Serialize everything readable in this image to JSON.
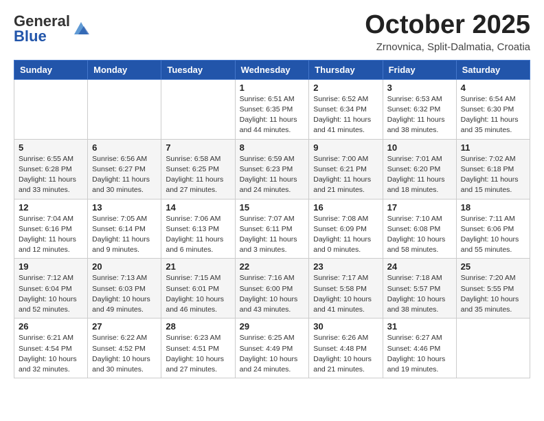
{
  "header": {
    "logo": {
      "general": "General",
      "blue": "Blue",
      "icon_title": "GeneralBlue Logo"
    },
    "title": "October 2025",
    "subtitle": "Zrnovnica, Split-Dalmatia, Croatia"
  },
  "weekdays": [
    "Sunday",
    "Monday",
    "Tuesday",
    "Wednesday",
    "Thursday",
    "Friday",
    "Saturday"
  ],
  "weeks": [
    [
      {
        "day": "",
        "info": ""
      },
      {
        "day": "",
        "info": ""
      },
      {
        "day": "",
        "info": ""
      },
      {
        "day": "1",
        "info": "Sunrise: 6:51 AM\nSunset: 6:35 PM\nDaylight: 11 hours\nand 44 minutes."
      },
      {
        "day": "2",
        "info": "Sunrise: 6:52 AM\nSunset: 6:34 PM\nDaylight: 11 hours\nand 41 minutes."
      },
      {
        "day": "3",
        "info": "Sunrise: 6:53 AM\nSunset: 6:32 PM\nDaylight: 11 hours\nand 38 minutes."
      },
      {
        "day": "4",
        "info": "Sunrise: 6:54 AM\nSunset: 6:30 PM\nDaylight: 11 hours\nand 35 minutes."
      }
    ],
    [
      {
        "day": "5",
        "info": "Sunrise: 6:55 AM\nSunset: 6:28 PM\nDaylight: 11 hours\nand 33 minutes."
      },
      {
        "day": "6",
        "info": "Sunrise: 6:56 AM\nSunset: 6:27 PM\nDaylight: 11 hours\nand 30 minutes."
      },
      {
        "day": "7",
        "info": "Sunrise: 6:58 AM\nSunset: 6:25 PM\nDaylight: 11 hours\nand 27 minutes."
      },
      {
        "day": "8",
        "info": "Sunrise: 6:59 AM\nSunset: 6:23 PM\nDaylight: 11 hours\nand 24 minutes."
      },
      {
        "day": "9",
        "info": "Sunrise: 7:00 AM\nSunset: 6:21 PM\nDaylight: 11 hours\nand 21 minutes."
      },
      {
        "day": "10",
        "info": "Sunrise: 7:01 AM\nSunset: 6:20 PM\nDaylight: 11 hours\nand 18 minutes."
      },
      {
        "day": "11",
        "info": "Sunrise: 7:02 AM\nSunset: 6:18 PM\nDaylight: 11 hours\nand 15 minutes."
      }
    ],
    [
      {
        "day": "12",
        "info": "Sunrise: 7:04 AM\nSunset: 6:16 PM\nDaylight: 11 hours\nand 12 minutes."
      },
      {
        "day": "13",
        "info": "Sunrise: 7:05 AM\nSunset: 6:14 PM\nDaylight: 11 hours\nand 9 minutes."
      },
      {
        "day": "14",
        "info": "Sunrise: 7:06 AM\nSunset: 6:13 PM\nDaylight: 11 hours\nand 6 minutes."
      },
      {
        "day": "15",
        "info": "Sunrise: 7:07 AM\nSunset: 6:11 PM\nDaylight: 11 hours\nand 3 minutes."
      },
      {
        "day": "16",
        "info": "Sunrise: 7:08 AM\nSunset: 6:09 PM\nDaylight: 11 hours\nand 0 minutes."
      },
      {
        "day": "17",
        "info": "Sunrise: 7:10 AM\nSunset: 6:08 PM\nDaylight: 10 hours\nand 58 minutes."
      },
      {
        "day": "18",
        "info": "Sunrise: 7:11 AM\nSunset: 6:06 PM\nDaylight: 10 hours\nand 55 minutes."
      }
    ],
    [
      {
        "day": "19",
        "info": "Sunrise: 7:12 AM\nSunset: 6:04 PM\nDaylight: 10 hours\nand 52 minutes."
      },
      {
        "day": "20",
        "info": "Sunrise: 7:13 AM\nSunset: 6:03 PM\nDaylight: 10 hours\nand 49 minutes."
      },
      {
        "day": "21",
        "info": "Sunrise: 7:15 AM\nSunset: 6:01 PM\nDaylight: 10 hours\nand 46 minutes."
      },
      {
        "day": "22",
        "info": "Sunrise: 7:16 AM\nSunset: 6:00 PM\nDaylight: 10 hours\nand 43 minutes."
      },
      {
        "day": "23",
        "info": "Sunrise: 7:17 AM\nSunset: 5:58 PM\nDaylight: 10 hours\nand 41 minutes."
      },
      {
        "day": "24",
        "info": "Sunrise: 7:18 AM\nSunset: 5:57 PM\nDaylight: 10 hours\nand 38 minutes."
      },
      {
        "day": "25",
        "info": "Sunrise: 7:20 AM\nSunset: 5:55 PM\nDaylight: 10 hours\nand 35 minutes."
      }
    ],
    [
      {
        "day": "26",
        "info": "Sunrise: 6:21 AM\nSunset: 4:54 PM\nDaylight: 10 hours\nand 32 minutes."
      },
      {
        "day": "27",
        "info": "Sunrise: 6:22 AM\nSunset: 4:52 PM\nDaylight: 10 hours\nand 30 minutes."
      },
      {
        "day": "28",
        "info": "Sunrise: 6:23 AM\nSunset: 4:51 PM\nDaylight: 10 hours\nand 27 minutes."
      },
      {
        "day": "29",
        "info": "Sunrise: 6:25 AM\nSunset: 4:49 PM\nDaylight: 10 hours\nand 24 minutes."
      },
      {
        "day": "30",
        "info": "Sunrise: 6:26 AM\nSunset: 4:48 PM\nDaylight: 10 hours\nand 21 minutes."
      },
      {
        "day": "31",
        "info": "Sunrise: 6:27 AM\nSunset: 4:46 PM\nDaylight: 10 hours\nand 19 minutes."
      },
      {
        "day": "",
        "info": ""
      }
    ]
  ],
  "colors": {
    "header_bg": "#2255aa",
    "header_text": "#ffffff",
    "border": "#cccccc"
  }
}
